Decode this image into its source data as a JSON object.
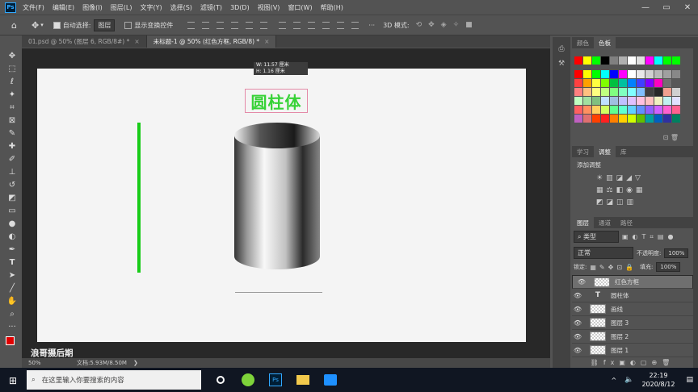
{
  "app": {
    "logo": "Ps"
  },
  "menu": [
    "文件(F)",
    "编辑(E)",
    "图像(I)",
    "图层(L)",
    "文字(Y)",
    "选择(S)",
    "滤镜(T)",
    "3D(D)",
    "视图(V)",
    "窗口(W)",
    "帮助(H)"
  ],
  "options": {
    "auto_select_label": "自动选择:",
    "auto_select_value": "图层",
    "show_transform_label": "显示变换控件",
    "mode_3d_label": "3D 模式:",
    "more": "···"
  },
  "tabs": [
    {
      "label": "01.psd @ 50% (图层 6, RGB/8#) *",
      "close": "×"
    },
    {
      "label": "未标题-1 @ 50% (红色方框, RGB/8) *",
      "close": "×"
    }
  ],
  "canvas": {
    "tooltip_w": "W:  11.57 厘米",
    "tooltip_h": "H:    1.16 厘米",
    "title_text": "圆柱体",
    "title_color": "#36d236",
    "green_line_color": "#18cc18"
  },
  "status": {
    "zoom": "50%",
    "doc_info": "文档:5.93M/8.50M",
    "arrow": "❯"
  },
  "watermark": "浪哥摄后期",
  "swatch_tabs": [
    "颜色",
    "色板"
  ],
  "learn_tabs": [
    "学习",
    "调整",
    "库"
  ],
  "adjust_title": "添加调整",
  "layers_tabs": [
    "图层",
    "通道",
    "路径"
  ],
  "layers_filter": "类型",
  "blend_mode": "正常",
  "opacity_label": "不透明度:",
  "opacity_value": "100%",
  "lock_label": "锁定:",
  "fill_label": "填充:",
  "fill_value": "100%",
  "layers": [
    {
      "name": "红色方框",
      "type": "thumb",
      "selected": true
    },
    {
      "name": "圆柱体",
      "type": "text",
      "selected": false
    },
    {
      "name": "画线",
      "type": "thumb",
      "selected": false
    },
    {
      "name": "图层 3",
      "type": "thumb",
      "selected": false
    },
    {
      "name": "图层 2",
      "type": "thumb",
      "selected": false
    },
    {
      "name": "图层 1",
      "type": "thumb",
      "selected": false
    }
  ],
  "taskbar": {
    "search_placeholder": "在这里输入你要搜索的内容",
    "time": "22:19",
    "date": "2020/8/12",
    "tray_caret": "^"
  }
}
